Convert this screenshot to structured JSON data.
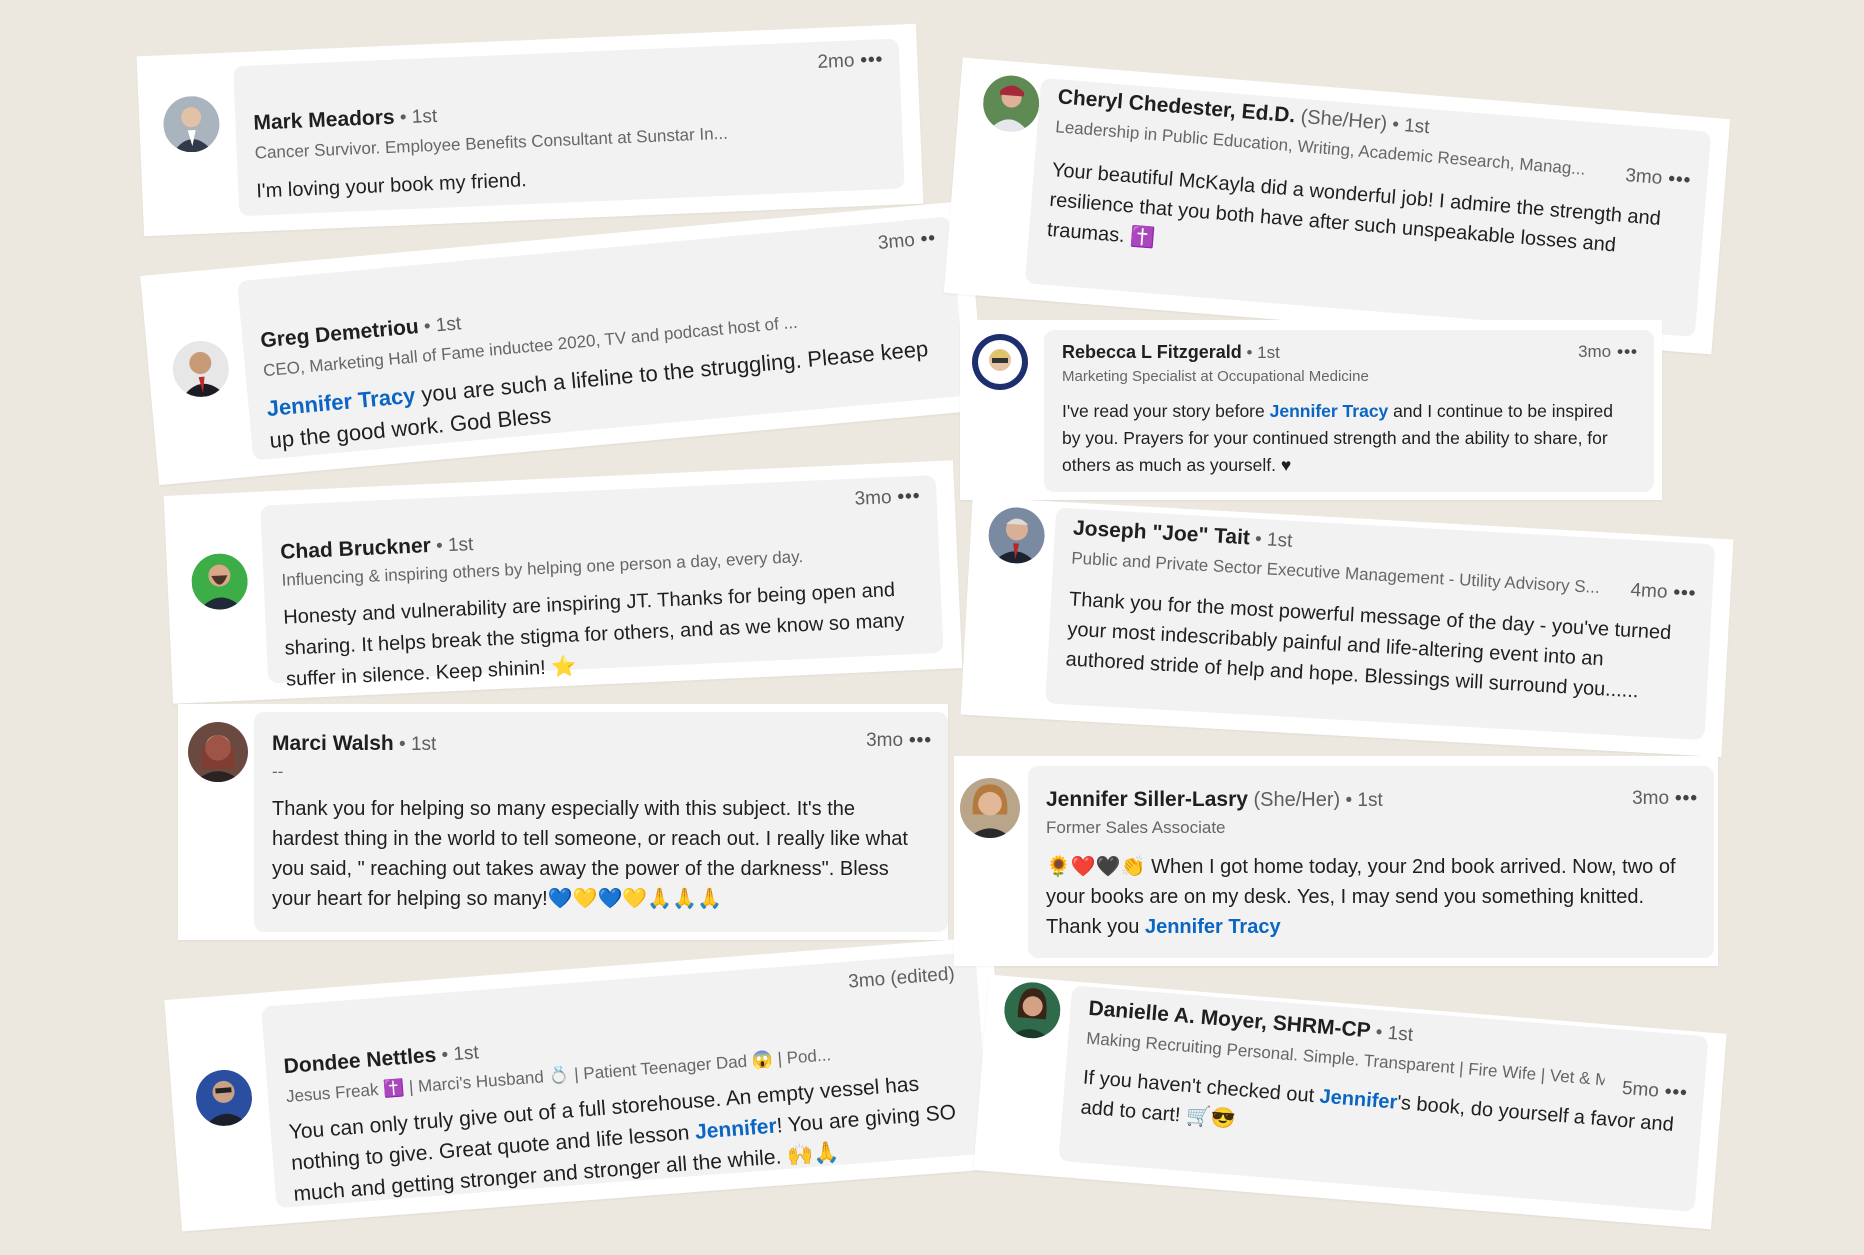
{
  "cards": {
    "mark": {
      "name": "Mark Meadors",
      "degree": " • 1st",
      "time": "2mo",
      "more": "•••",
      "headline": "Cancer Survivor. Employee Benefits Consultant at Sunstar In...",
      "text": "I'm loving your book my friend."
    },
    "greg": {
      "name": "Greg Demetriou",
      "degree": " • 1st",
      "time": "3mo",
      "more": "••",
      "headline": "CEO, Marketing Hall of Fame inductee 2020, TV and podcast host of ...",
      "mention": "Jennifer Tracy",
      "text": " you are such a lifeline to the struggling. Please keep up the good work. God Bless"
    },
    "chad": {
      "name": "Chad Bruckner",
      "degree": " • 1st",
      "time": "3mo",
      "more": "•••",
      "headline": "Influencing & inspiring others by helping one person a day, every day.",
      "text": "Honesty and vulnerability are inspiring JT. Thanks for being open and sharing. It helps break the stigma for others, and as we know so many suffer in silence. Keep shinin! ⭐"
    },
    "marci": {
      "name": "Marci Walsh",
      "degree": " • 1st",
      "time": "3mo",
      "more": "•••",
      "headline": "--",
      "text": "Thank you for helping so many especially with this subject. It's the hardest thing in the world to tell someone, or reach out. I really like what you said, \" reaching out takes away the power of the darkness\". Bless your heart for helping so many!💙💛💙💛🙏🙏🙏"
    },
    "dondee": {
      "name": "Dondee Nettles",
      "degree": " • 1st",
      "time": "3mo (edited)",
      "more": "",
      "headline": "Jesus Freak ✝️ | Marci's Husband 💍 | Patient Teenager Dad 😱 | Pod...",
      "text_before": "You can only truly give out of a full storehouse. An empty vessel has nothing to give. Great quote and life lesson ",
      "mention": "Jennifer",
      "text_after": "! You are giving SO much and getting stronger and stronger all the while. 🙌🙏"
    },
    "cheryl": {
      "name": "Cheryl Chedester, Ed.D.",
      "pronoun": " (She/Her)",
      "degree": " • 1st",
      "time": "3mo",
      "more": "•••",
      "headline": "Leadership in Public Education, Writing, Academic Research, Manag...",
      "text": "Your beautiful McKayla did a wonderful job! I admire the strength and resilience that you both have after such unspeakable losses and traumas. ✝️"
    },
    "rebecca": {
      "name": "Rebecca L Fitzgerald",
      "degree": " • 1st",
      "time": "3mo",
      "more": "•••",
      "headline": "Marketing Specialist at Occupational Medicine",
      "text_before": "I've read your story before ",
      "mention": "Jennifer Tracy",
      "text_after": " and I continue to be inspired by you. Prayers for your continued strength and the ability to share, for others as much as yourself. ♥"
    },
    "joseph": {
      "name": "Joseph \"Joe\" Tait",
      "degree": " • 1st",
      "time": "4mo",
      "more": "•••",
      "headline": "Public and Private Sector Executive Management - Utility Advisory S...",
      "text": "Thank you for the most powerful message of the day - you've turned your most indescribably painful and life-altering event into an authored stride of help and hope. Blessings will surround you......"
    },
    "jennifer": {
      "name": "Jennifer Siller-Lasry",
      "pronoun": " (She/Her)",
      "degree": " • 1st",
      "time": "3mo",
      "more": "•••",
      "headline": "Former Sales Associate",
      "text_before": "🌻❤️🖤👏 When I got home today, your 2nd book arrived. Now, two of your books are on my desk. Yes, I may send you something knitted. Thank you ",
      "mention": "Jennifer Tracy"
    },
    "danielle": {
      "name": "Danielle A. Moyer, SHRM-CP",
      "degree": " • 1st",
      "time": "5mo",
      "more": "•••",
      "headline": "Making Recruiting Personal. Simple. Transparent | Fire Wife | Vet & M...",
      "text_before": "If you haven't checked out ",
      "mention": "Jennifer",
      "text_after": "'s book, do yourself a favor and add to cart! 🛒😎"
    }
  },
  "colors": {
    "background": "#ece8df",
    "bubble": "#f2f2f2",
    "mention": "#0a66c2"
  },
  "icons": {
    "avatar": "profile-photo",
    "more": "more-options-icon"
  }
}
